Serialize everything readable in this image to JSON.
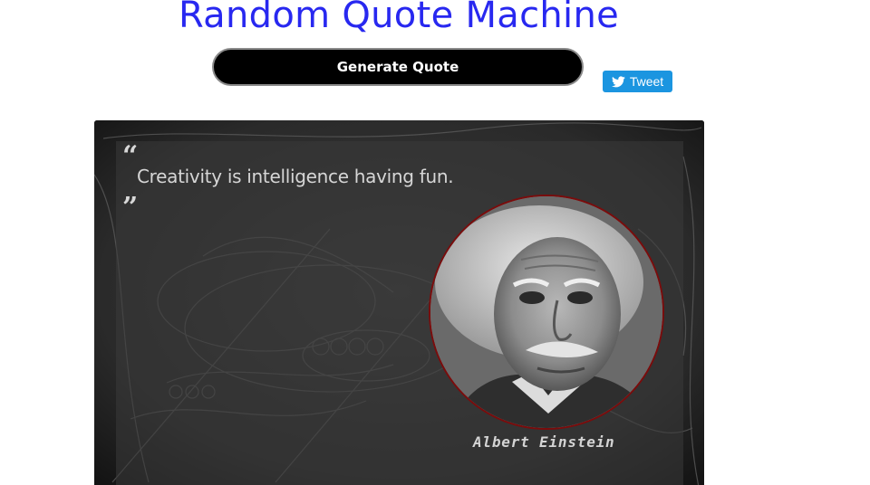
{
  "header": {
    "title": "Random Quote Machine"
  },
  "actions": {
    "generate_label": "Generate Quote",
    "tweet_label": "Tweet",
    "tweet_icon": "twitter-bird-icon"
  },
  "quote": {
    "open_mark": "“",
    "close_mark": "”",
    "text": "Creativity is intelligence having fun.",
    "author": "Albert Einstein",
    "portrait_icon": "author-portrait"
  },
  "colors": {
    "title": "#2828f0",
    "generate_bg": "#000000",
    "tweet_bg": "#1b95e0",
    "panel_bg": "#2c2c2c",
    "portrait_border": "#7a0c0c"
  }
}
